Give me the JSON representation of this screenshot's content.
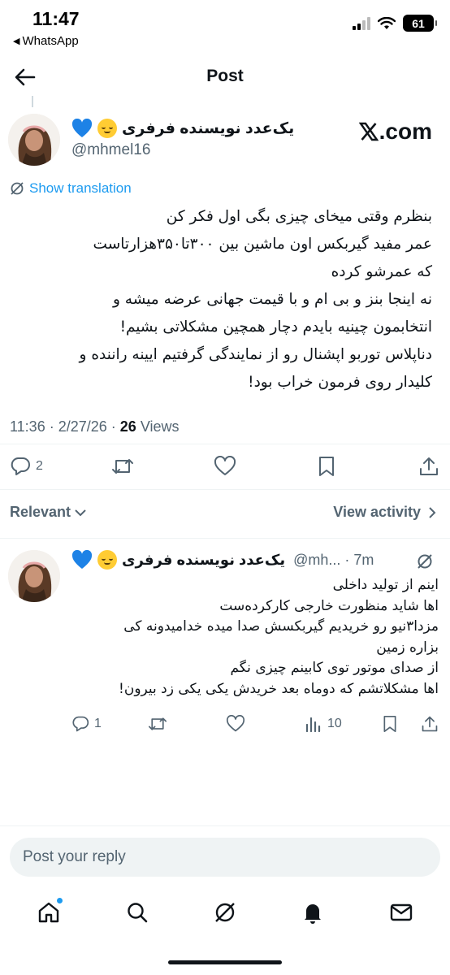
{
  "status_bar": {
    "time": "11:47",
    "back_app": "WhatsApp",
    "battery": "61"
  },
  "header": {
    "title": "Post"
  },
  "post": {
    "author_name": "یک‌عدد نویسنده فرفری",
    "handle": "@mhmel16",
    "brand": ".com",
    "translate_label": "Show translation",
    "lines": [
      "بنظرم وقتی میخای چیزی بگی اول فکر کن",
      "عمر مفید گیربکس اون ماشین بین ۳۰۰تا۳۵۰هزارتاست",
      "که عمرشو کرده",
      "نه اینجا بنز و بی ام و با قیمت جهانی عرضه میشه و",
      "انتخابمون چینیه بایدم دچار همچین مشکلاتی بشیم!",
      "دناپلاس توربو اپشنال رو از نمایندگی گرفتیم ایینه راننده و",
      "کلیدار روی فرمون خراب بود!"
    ],
    "time": "11:36",
    "date": "2/27/26",
    "views_count": "26",
    "views_label": "Views",
    "reply_count": "2"
  },
  "sort": {
    "relevant": "Relevant",
    "view_activity": "View activity"
  },
  "reply": {
    "author_name": "یک‌عدد نویسنده فرفری",
    "handle_time": "@mh... · 7m",
    "lines": [
      "اینم از تولید داخلی",
      "اها شاید منظورت خارجی کارکرده‌ست",
      "مزدا۳نیو رو خریدیم گیربکسش صدا میده خدامیدونه کی",
      "بزاره زمین",
      "از صدای موتور توی کابینم چیزی نگم",
      "اها مشکلاتشم که دوماه بعد خریدش یکی یکی زد بیرون!"
    ],
    "reply_count": "1",
    "views_count": "10"
  },
  "composer": {
    "placeholder": "Post your reply"
  },
  "colors": {
    "accent": "#1d9bf0",
    "heart_blue": "#1d82e6",
    "text": "#0f1419",
    "muted": "#536471"
  },
  "icons": [
    "back-arrow-icon",
    "grok-icon",
    "reply-icon",
    "repost-icon",
    "like-icon",
    "bookmark-icon",
    "share-icon",
    "views-icon",
    "home-icon",
    "search-icon",
    "bell-icon",
    "mail-icon"
  ]
}
